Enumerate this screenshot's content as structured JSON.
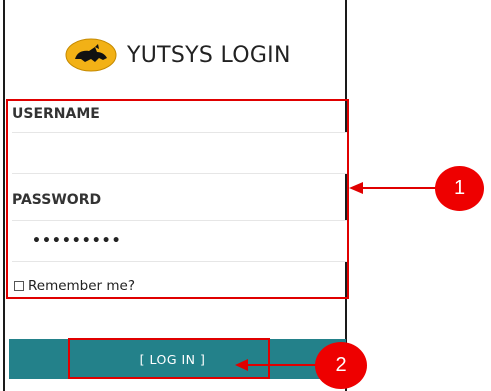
{
  "login_panel": {
    "title": "YUTSYS LOGIN",
    "logo_icon": "yellow-cat-logo-icon",
    "username": {
      "label": "USERNAME",
      "value": ""
    },
    "password": {
      "label": "PASSWORD",
      "value": "•••••••••"
    },
    "remember": {
      "label": "Remember me?",
      "checked": false
    },
    "login_button": {
      "label": "[ LOG IN ]"
    }
  },
  "annotations": {
    "callout_1": "1",
    "callout_2": "2",
    "highlight_color": "#e00000"
  },
  "colors": {
    "login_bar": "#23818a",
    "callout_fill": "#ee0000"
  }
}
